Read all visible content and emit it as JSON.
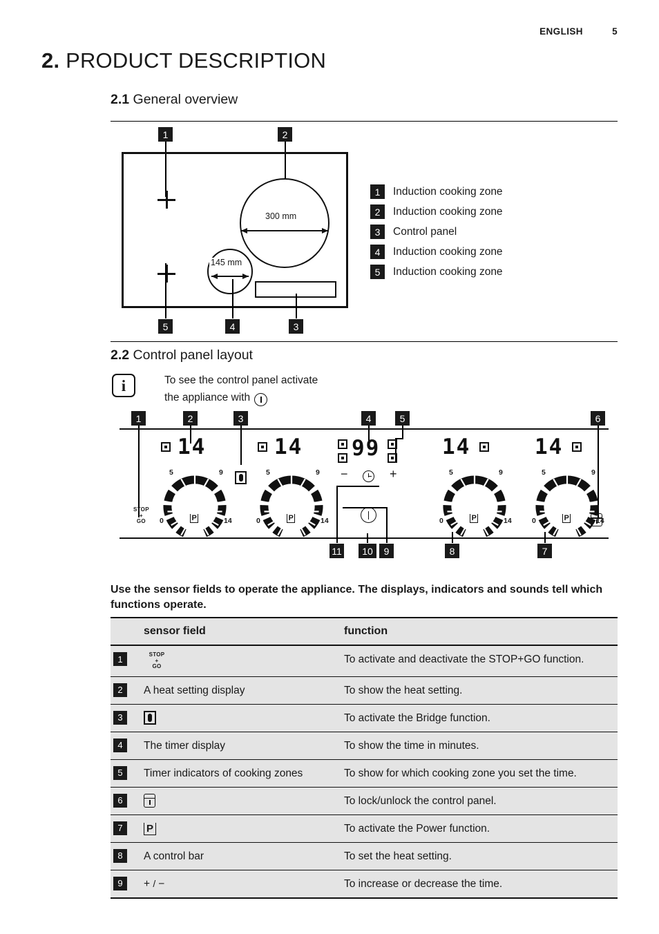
{
  "header": {
    "language": "ENGLISH",
    "page_number": "5"
  },
  "chapter": {
    "number": "2.",
    "title": "PRODUCT DESCRIPTION"
  },
  "sections": {
    "overview": {
      "number": "2.1",
      "title": "General overview"
    },
    "control_panel": {
      "number": "2.2",
      "title": "Control panel layout"
    }
  },
  "hob_diagram": {
    "callouts": {
      "c1": "1",
      "c2": "2",
      "c3": "3",
      "c4": "4",
      "c5": "5"
    },
    "dimension_large": "300 mm",
    "dimension_small": "145 mm"
  },
  "legend": [
    {
      "num": "1",
      "label": "Induction cooking zone"
    },
    {
      "num": "2",
      "label": "Induction cooking zone"
    },
    {
      "num": "3",
      "label": "Control panel"
    },
    {
      "num": "4",
      "label": "Induction cooking zone"
    },
    {
      "num": "5",
      "label": "Induction cooking zone"
    }
  ],
  "note": {
    "icon": "info-icon",
    "line1": "To see the control panel activate",
    "line2": "the appliance with"
  },
  "control_panel_diagram": {
    "callouts": {
      "c1": "1",
      "c2": "2",
      "c3": "3",
      "c4": "4",
      "c5": "5",
      "c6": "6",
      "c7": "7",
      "c8": "8",
      "c9": "9",
      "c10": "10",
      "c11": "11"
    },
    "zone_display": "14",
    "timer_display": "99",
    "scale": {
      "zero": "0",
      "five": "5",
      "nine": "9",
      "fourteen": "14"
    },
    "power_marker": "P",
    "stop_go": {
      "line1": "STOP",
      "line2": "+",
      "line3": "GO"
    },
    "minus": "−",
    "plus": "+"
  },
  "intro": "Use the sensor fields to operate the appliance. The displays, indicators and sounds tell which functions operate.",
  "table": {
    "headers": {
      "num": "",
      "sensor_field": "sensor field",
      "function": "function"
    },
    "rows": [
      {
        "num": "1",
        "sensor": "",
        "sensor_icon": "stop-go-icon",
        "function": "To activate and deactivate the STOP+GO function."
      },
      {
        "num": "2",
        "sensor": "A heat setting display",
        "sensor_icon": "",
        "function": "To show the heat setting."
      },
      {
        "num": "3",
        "sensor": "",
        "sensor_icon": "bridge-icon",
        "function": "To activate the Bridge function."
      },
      {
        "num": "4",
        "sensor": "The timer display",
        "sensor_icon": "",
        "function": "To show the time in minutes."
      },
      {
        "num": "5",
        "sensor": "Timer indicators of cooking zones",
        "sensor_icon": "",
        "function": "To show for which cooking zone you set the time."
      },
      {
        "num": "6",
        "sensor": "",
        "sensor_icon": "lock-icon",
        "function": "To lock/unlock the control panel."
      },
      {
        "num": "7",
        "sensor": "",
        "sensor_icon": "power-function-icon",
        "function": "To activate the Power function."
      },
      {
        "num": "8",
        "sensor": "A control bar",
        "sensor_icon": "",
        "function": "To set the heat setting."
      },
      {
        "num": "9",
        "sensor": "",
        "sensor_icon": "plus-minus-icon",
        "function": "To increase or decrease the time."
      }
    ]
  }
}
